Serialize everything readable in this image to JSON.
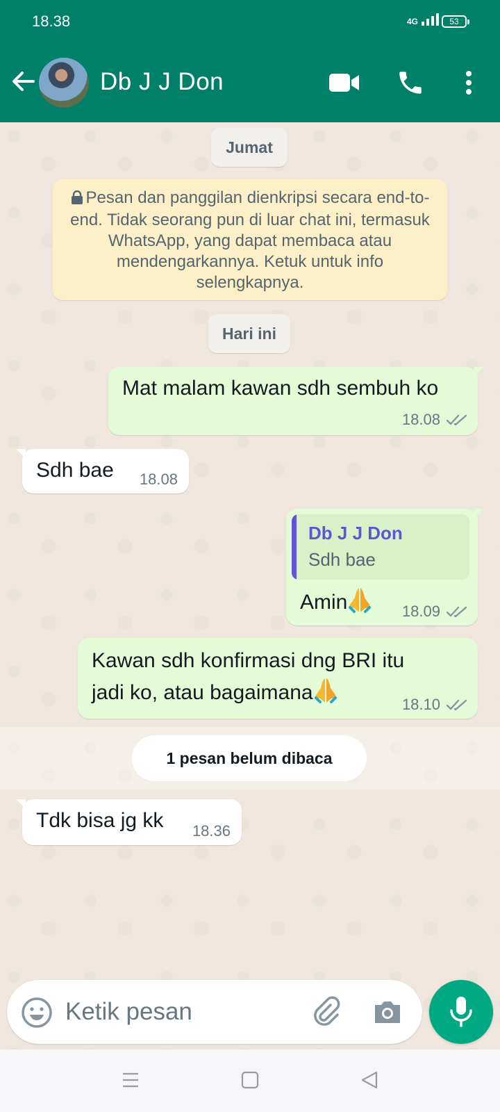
{
  "status_bar": {
    "time": "18.38",
    "network": "4G",
    "battery": "53"
  },
  "header": {
    "contact_name": "Db J J Don"
  },
  "chat": {
    "date_chips": [
      "Jumat",
      "Hari ini"
    ],
    "encryption_notice": "Pesan dan panggilan dienkripsi secara end-to-end. Tidak seorang pun di luar chat ini, termasuk WhatsApp, yang dapat membaca atau mendengarkannya. Ketuk untuk info selengkapnya.",
    "messages": [
      {
        "direction": "out",
        "text": "Mat malam kawan sdh sembuh ko",
        "time": "18.08",
        "status": "read"
      },
      {
        "direction": "in",
        "text": "Sdh bae",
        "time": "18.08"
      },
      {
        "direction": "out",
        "quote_author": "Db J J Don",
        "quote_text": "Sdh bae",
        "text": "Amin",
        "emoji": "folded-hands",
        "time": "18.09",
        "status": "read"
      },
      {
        "direction": "out",
        "text_line1": "Kawan sdh konfirmasi dng BRI itu",
        "text_line2": "jadi ko, atau bagaimana",
        "emoji": "folded-hands",
        "time": "18.10",
        "status": "read"
      },
      {
        "direction": "in",
        "text": "Tdk bisa jg kk",
        "time": "18.36"
      }
    ],
    "unread_label": "1 pesan belum dibaca"
  },
  "composer": {
    "placeholder": "Ketik pesan"
  },
  "colors": {
    "header": "#008069",
    "accent": "#00a884",
    "outgoing_bubble": "#e3fcd7",
    "incoming_bubble": "#ffffff",
    "quote_author": "#5e55d6",
    "notice_bg": "#fdf0c9"
  }
}
